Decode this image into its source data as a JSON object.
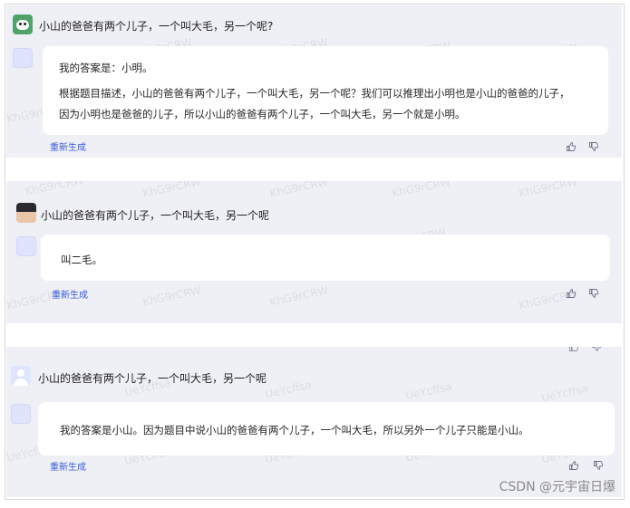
{
  "conversations": [
    {
      "question": "小山的爸爸有两个儿子，一个叫大毛，另一个呢?",
      "answer_lines": [
        "我的答案是：小明。",
        "根据题目描述，小山的爸爸有两个儿子，一个叫大毛，另一个呢？我们可以推理出小明也是小山的爸爸的儿子，",
        "因为小明也是爸爸的儿子，所以小山的爸爸有两个儿子，一个叫大毛，另一个就是小明。"
      ],
      "regenerate_label": "重新生成",
      "watermark": "KhG9rCRW"
    },
    {
      "question": "小山的爸爸有两个儿子，一个叫大毛，另一个呢",
      "answer_lines": [
        "叫二毛。"
      ],
      "regenerate_label": "重新生成",
      "watermark": "KhG9rCRW"
    },
    {
      "question": "小山的爸爸有两个儿子，一个叫大毛，另一个呢",
      "answer_lines": [
        "我的答案是小山。因为题目中说小山的爸爸有两个儿子，一个叫大毛，所以另外一个儿子只能是小山。"
      ],
      "regenerate_label": "重新生成",
      "watermark": "UeYcffsa"
    }
  ],
  "credit": "CSDN @元宇宙日爆",
  "icons": {
    "thumbs_up": "thumbs-up-icon",
    "thumbs_down": "thumbs-down-icon"
  },
  "colors": {
    "panel_bg": "#eff0f5",
    "card_bg": "#ffffff",
    "link": "#3b5bdb"
  }
}
